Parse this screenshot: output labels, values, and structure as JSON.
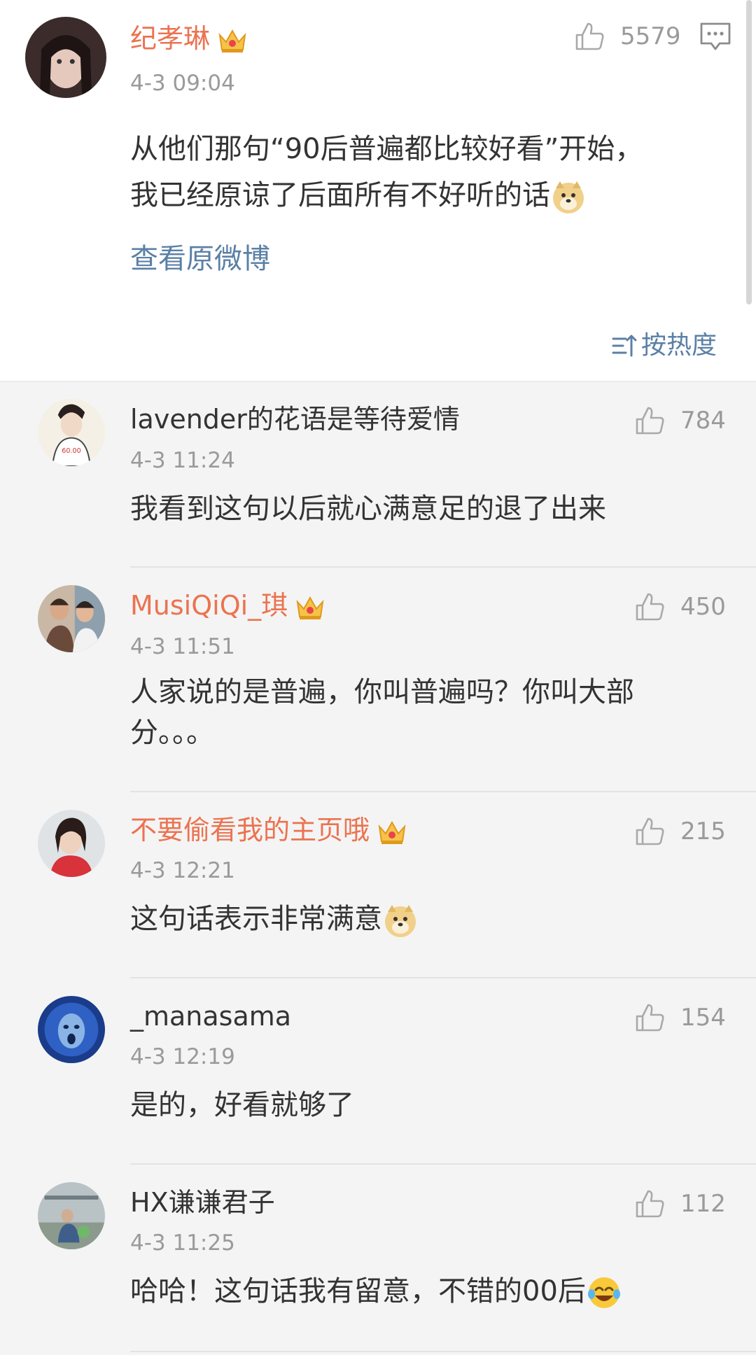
{
  "post": {
    "author": "纪孝琳",
    "time": "4-3 09:04",
    "likes": "5579",
    "text_line1": "从他们那句“90后普遍都比较好看”开始，",
    "text_line2": "我已经原谅了后面所有不好听的话",
    "view_original": "查看原微博",
    "sort_label": "按热度"
  },
  "comments": [
    {
      "name": "lavender的花语是等待爱情",
      "time": "4-3 11:24",
      "likes": "784",
      "text": "我看到这句以后就心满意足的退了出来"
    },
    {
      "name": "MusiQiQi_琪",
      "time": "4-3 11:51",
      "likes": "450",
      "text_line1": "人家说的是普遍，你叫普遍吗？你叫大部",
      "text_line2": "分。。。"
    },
    {
      "name": "不要偷看我的主页哦",
      "time": "4-3 12:21",
      "likes": "215",
      "text": "这句话表示非常满意"
    },
    {
      "name": "_manasama",
      "time": "4-3 12:19",
      "likes": "154",
      "text": "是的，好看就够了"
    },
    {
      "name": "HX谦谦君子",
      "time": "4-3 11:25",
      "likes": "112",
      "text": "哈哈！这句话我有留意，不错的00后"
    }
  ],
  "colors": {
    "vip_name": "#eb7350",
    "link": "#5b80a6",
    "meta": "#9a9a9a",
    "background": "#f4f4f4"
  }
}
